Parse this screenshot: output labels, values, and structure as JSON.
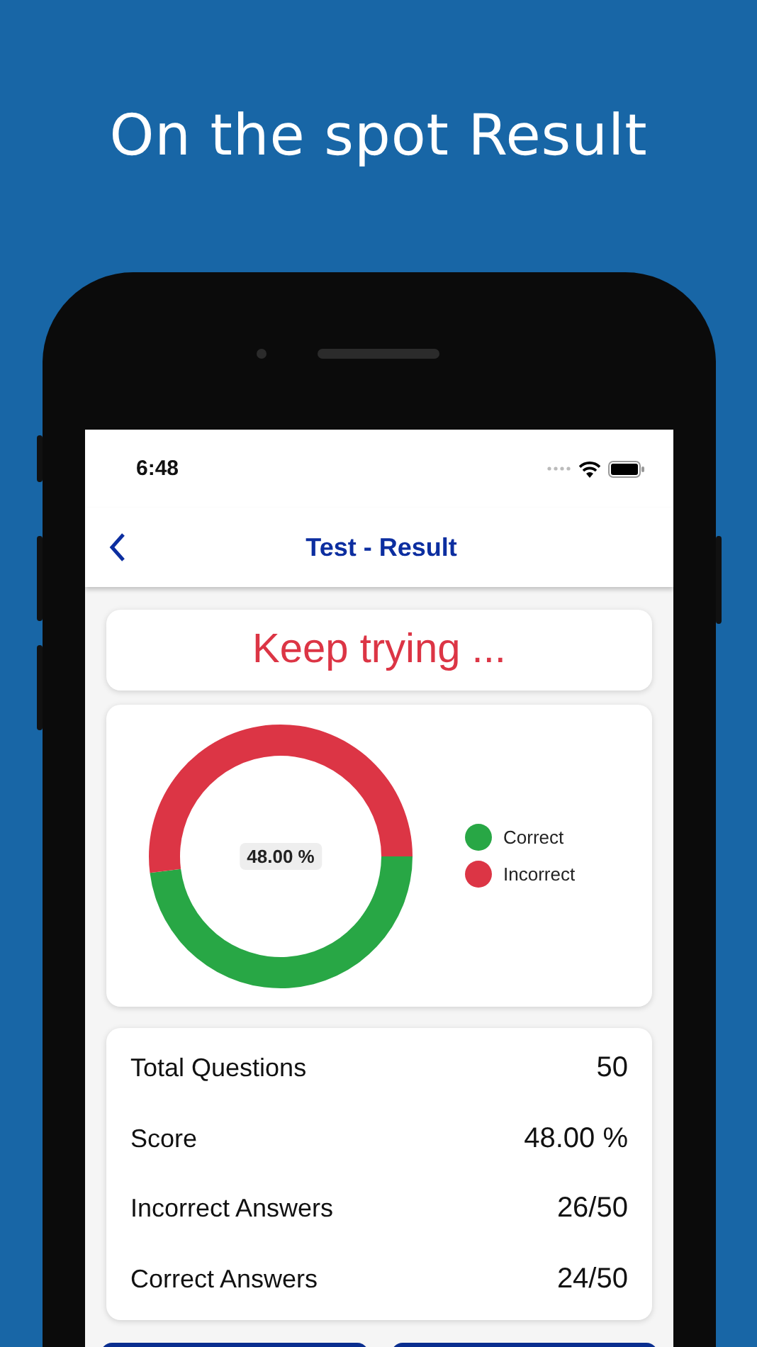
{
  "headline": "On the spot Result",
  "status_bar": {
    "time": "6:48"
  },
  "nav": {
    "title": "Test - Result"
  },
  "message": "Keep trying ...",
  "chart": {
    "center_label": "48.00 %",
    "chart_data": {
      "type": "donut",
      "categories": [
        "Correct",
        "Incorrect"
      ],
      "values": [
        48,
        52
      ],
      "colors": [
        "#28a745",
        "#dc3545"
      ]
    }
  },
  "stats": [
    {
      "label": "Total Questions",
      "value": "50"
    },
    {
      "label": "Score",
      "value": "48.00 %"
    },
    {
      "label": "Incorrect Answers",
      "value": "26/50"
    },
    {
      "label": "Correct Answers",
      "value": "24/50"
    }
  ],
  "buttons": [
    {
      "kind": "primary"
    },
    {
      "kind": "primary"
    }
  ]
}
